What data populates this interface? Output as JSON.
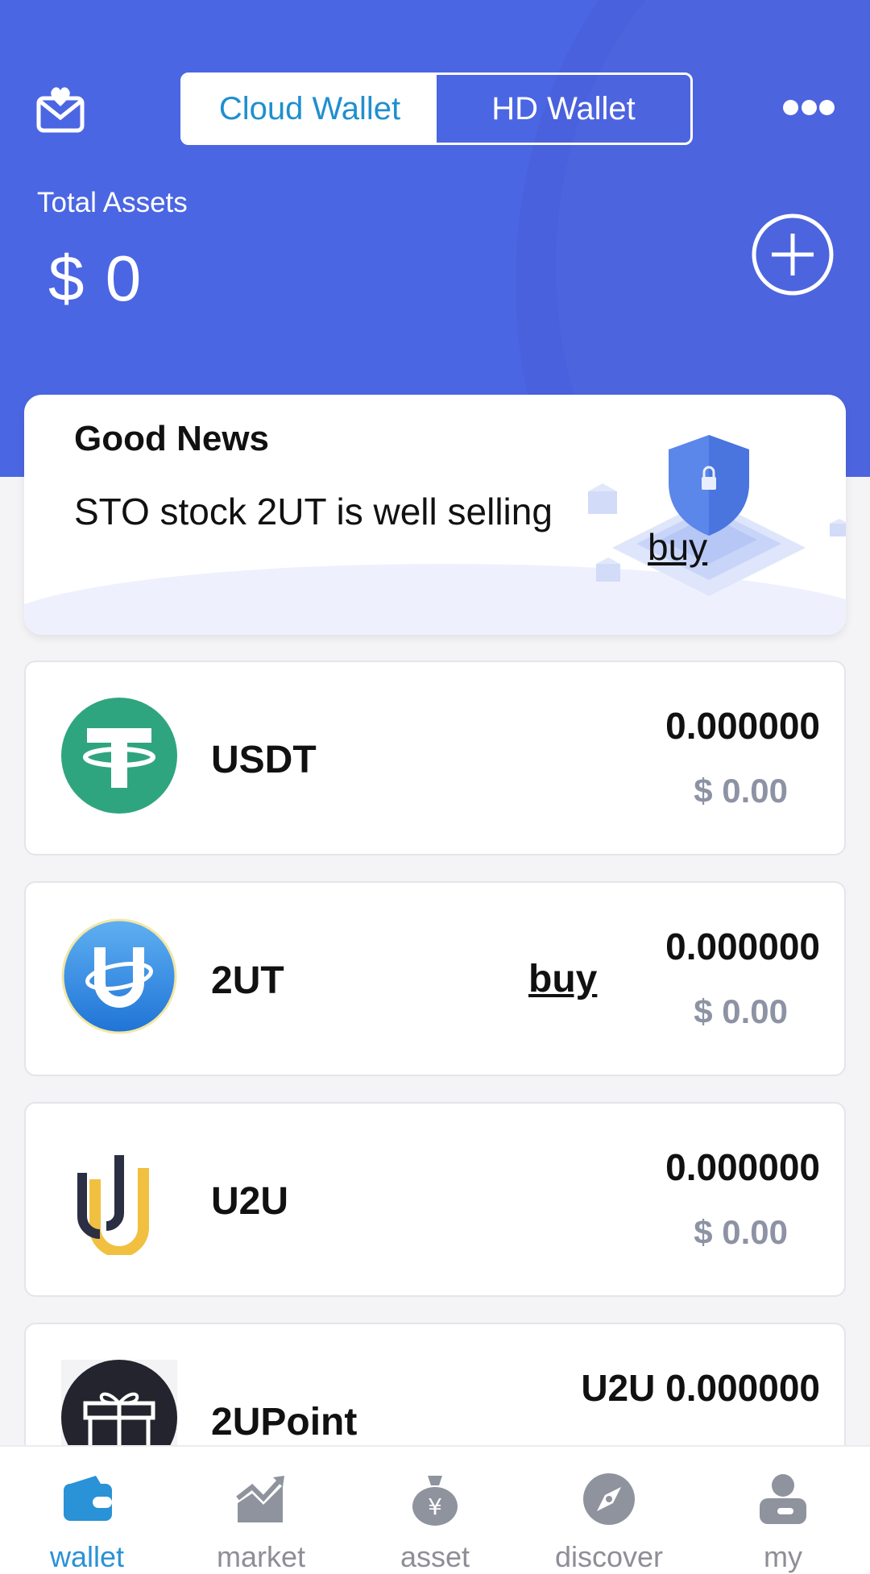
{
  "header": {
    "segments": [
      "Cloud Wallet",
      "HD Wallet"
    ],
    "active_segment": "Cloud Wallet",
    "total_label": "Total Assets",
    "total_value": "$ 0"
  },
  "news": {
    "title": "Good News",
    "text": "STO stock 2UT is well selling",
    "buy_label": "buy"
  },
  "coins": [
    {
      "name": "USDT",
      "amount": "0.000000",
      "value": "$ 0.00",
      "icon": "tether-icon",
      "color": "#2fa57f"
    },
    {
      "name": "2UT",
      "amount": "0.000000",
      "value": "$ 0.00",
      "buy_label": "buy",
      "icon": "2ut-icon",
      "color": "#3a8fe0"
    },
    {
      "name": "U2U",
      "amount": "0.000000",
      "value": "$ 0.00",
      "icon": "u2u-icon",
      "color": "#f1c040"
    },
    {
      "name": "2UPoint",
      "amount": "U2U 0.000000",
      "icon": "gift-icon",
      "color": "#24242e"
    }
  ],
  "tabs": [
    {
      "label": "wallet",
      "icon": "wallet-icon",
      "active": true
    },
    {
      "label": "market",
      "icon": "chart-trend-icon",
      "active": false
    },
    {
      "label": "asset",
      "icon": "money-bag-icon",
      "active": false
    },
    {
      "label": "discover",
      "icon": "compass-icon",
      "active": false
    },
    {
      "label": "my",
      "icon": "user-icon",
      "active": false
    }
  ],
  "colors": {
    "primary": "#4b66e3",
    "active_tab": "#2a92d6",
    "muted_value": "#8d93a4"
  }
}
